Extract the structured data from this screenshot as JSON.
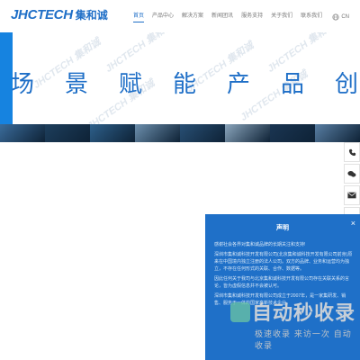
{
  "header": {
    "logo_latin": "JHCTECH",
    "logo_cn": "集和诚",
    "nav": [
      "首页",
      "产品中心",
      "解决方案",
      "新闻团讯",
      "服务支持",
      "关于我们",
      "联系我们"
    ],
    "active_nav": "首页",
    "lang": "CN"
  },
  "hero": {
    "chars": [
      "场",
      "景",
      "赋",
      "能",
      "产",
      "品",
      "创"
    ],
    "watermark": "JHCTECH 集和诚"
  },
  "strip": {
    "colors": [
      "#3a6b9a",
      "#1d3e5c",
      "#2d5f8a",
      "#6c8fad",
      "#284f74",
      "#8aa5bc",
      "#1a3552",
      "#587ea3"
    ]
  },
  "floatbar": {
    "icons": [
      "phone-icon",
      "wechat-icon",
      "email-icon",
      "top-icon"
    ]
  },
  "modal": {
    "title": "声明",
    "close": "×",
    "paragraphs": [
      "感谢社会各界对集和诚品牌的长期关注和支持!",
      "深圳市集和诚科技开发有限公司(北京集和诚科技开发有限公司前身)原来在中国境内独立注册的法人公司。双方的品牌、业务和运营均为独立，不存在任何形式的关联、合作、数据等。",
      "因此任何关于我司与北京集和诚科技开发有限公司存在关联关系的言论，皆为虚假信息并不会被认可。",
      "深圳市集和诚科技开发有限公司成立于2007年，是一家集研发、销售、服务于一体的国家高新技术企业。"
    ]
  },
  "overlay": {
    "big": "自动秒收录",
    "small": "极速收录 来访一次 自动收录"
  }
}
